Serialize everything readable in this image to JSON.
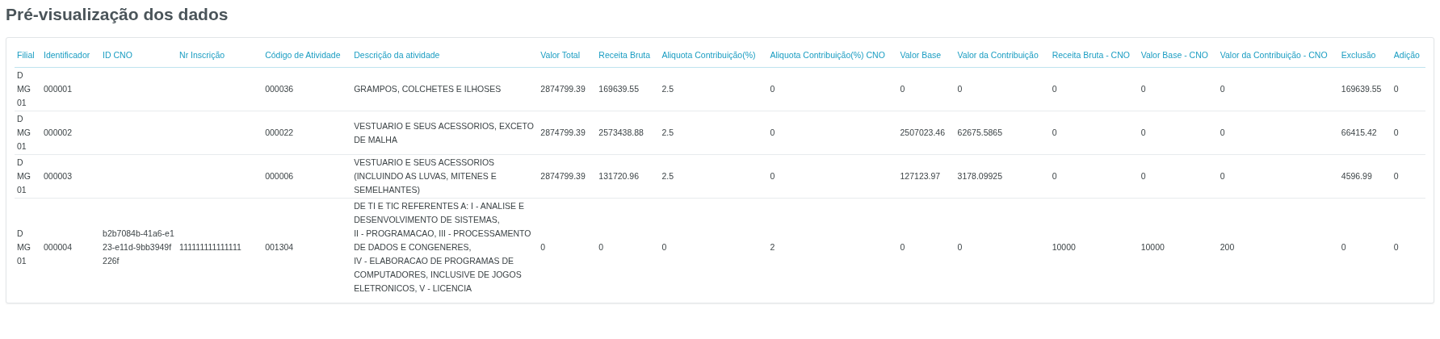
{
  "title": "Pré-visualização dos dados",
  "table": {
    "columns": [
      "Filial",
      "Identificador",
      "ID CNO",
      "Nr Inscrição",
      "Código de Atividade",
      "Descrição da atividade",
      "Valor Total",
      "Receita Bruta",
      "Aliquota Contribuição(%)",
      "Aliquota Contribuição(%) CNO",
      "Valor Base",
      "Valor da Contribuição",
      "Receita Bruta - CNO",
      "Valor Base - CNO",
      "Valor da Contribuição - CNO",
      "Exclusão",
      "Adição"
    ],
    "rows": [
      [
        "D MG 01",
        "000001",
        "",
        "",
        "000036",
        "GRAMPOS, COLCHETES E ILHOSES",
        "2874799.39",
        "169639.55",
        "2.5",
        "0",
        "0",
        "0",
        "0",
        "0",
        "0",
        "169639.55",
        "0"
      ],
      [
        "D MG 01",
        "000002",
        "",
        "",
        "000022",
        "VESTUARIO E SEUS ACESSORIOS, EXCETO DE MALHA",
        "2874799.39",
        "2573438.88",
        "2.5",
        "0",
        "2507023.46",
        "62675.5865",
        "0",
        "0",
        "0",
        "66415.42",
        "0"
      ],
      [
        "D MG 01",
        "000003",
        "",
        "",
        "000006",
        "VESTUARIO E SEUS ACESSORIOS (INCLUINDO AS LUVAS, MITENES E SEMELHANTES)",
        "2874799.39",
        "131720.96",
        "2.5",
        "0",
        "127123.97",
        "3178.09925",
        "0",
        "0",
        "0",
        "4596.99",
        "0"
      ],
      [
        "D MG 01",
        "000004",
        "b2b7084b-41a6-e123-e11d-9bb3949f226f",
        "111111111111111",
        "001304",
        "DE TI E TIC REFERENTES A: I - ANALISE E DESENVOLVIMENTO DE SISTEMAS,\nII - PROGRAMACAO, III - PROCESSAMENTO DE DADOS E CONGENERES,\nIV - ELABORACAO DE PROGRAMAS DE COMPUTADORES, INCLUSIVE DE JOGOS ELETRONICOS, V - LICENCIA",
        "0",
        "0",
        "0",
        "2",
        "0",
        "0",
        "10000",
        "10000",
        "200",
        "0",
        "0"
      ]
    ]
  }
}
